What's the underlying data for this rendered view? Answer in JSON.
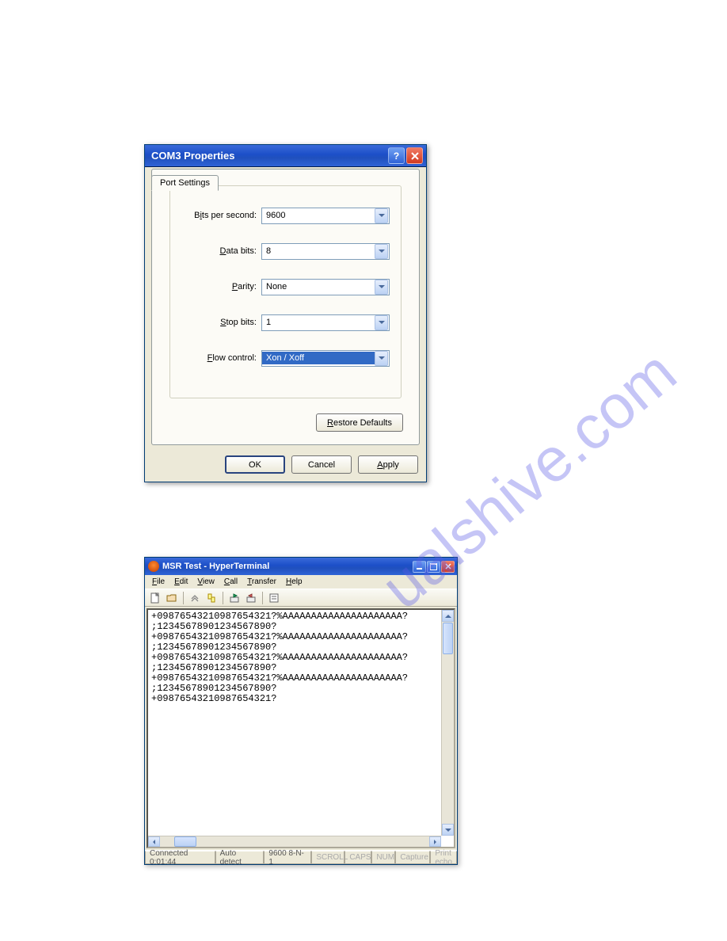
{
  "dialog": {
    "title": "COM3 Properties",
    "tab": "Port Settings",
    "fields": {
      "bits_per_second": {
        "label_pre": "B",
        "label_ul": "i",
        "label_post": "ts per second:",
        "value": "9600"
      },
      "data_bits": {
        "label_pre": "",
        "label_ul": "D",
        "label_post": "ata bits:",
        "value": "8"
      },
      "parity": {
        "label_pre": "",
        "label_ul": "P",
        "label_post": "arity:",
        "value": "None"
      },
      "stop_bits": {
        "label_pre": "",
        "label_ul": "S",
        "label_post": "top bits:",
        "value": "1"
      },
      "flow_control": {
        "label_pre": "",
        "label_ul": "F",
        "label_post": "low control:",
        "value": "Xon / Xoff"
      }
    },
    "restore_pre": "",
    "restore_ul": "R",
    "restore_post": "estore Defaults",
    "ok": "OK",
    "cancel": "Cancel",
    "apply_pre": "",
    "apply_ul": "A",
    "apply_post": "pply"
  },
  "hyperterm": {
    "title": "MSR Test - HyperTerminal",
    "menus": {
      "file": {
        "ul": "F",
        "post": "ile"
      },
      "edit": {
        "ul": "E",
        "post": "dit"
      },
      "view": {
        "ul": "V",
        "post": "iew"
      },
      "call": {
        "ul": "C",
        "post": "all"
      },
      "transfer": {
        "ul": "T",
        "post": "ransfer"
      },
      "help": {
        "ul": "H",
        "post": "elp"
      }
    },
    "lines": [
      "+09876543210987654321?%AAAAAAAAAAAAAAAAAAAAA?",
      ";12345678901234567890?",
      "+09876543210987654321?%AAAAAAAAAAAAAAAAAAAAA?",
      ";12345678901234567890?",
      "+09876543210987654321?%AAAAAAAAAAAAAAAAAAAAA?",
      ";12345678901234567890?",
      "+09876543210987654321?%AAAAAAAAAAAAAAAAAAAAA?",
      ";12345678901234567890?",
      "+09876543210987654321?"
    ],
    "status": {
      "connected": "Connected 0:01:44",
      "auto_detect": "Auto detect",
      "params": "9600 8-N-1",
      "scroll": "SCROLL",
      "caps": "CAPS",
      "num": "NUM",
      "capture": "Capture",
      "printecho": "Print echo"
    }
  },
  "watermark": "ualshive.com"
}
